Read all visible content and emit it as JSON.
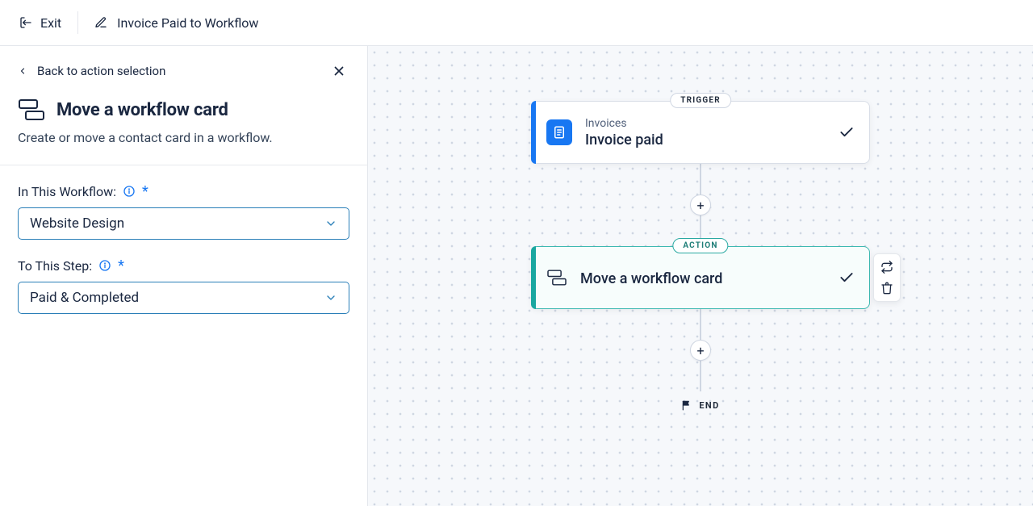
{
  "topbar": {
    "exit_label": "Exit",
    "workflow_name": "Invoice Paid to Workflow"
  },
  "panel": {
    "back_label": "Back to action selection",
    "title": "Move a workflow card",
    "description": "Create or move a contact card in a workflow.",
    "fields": {
      "workflow": {
        "label": "In This Workflow:",
        "value": "Website Design"
      },
      "step": {
        "label": "To This Step:",
        "value": "Paid & Completed"
      }
    }
  },
  "flow": {
    "trigger_badge": "TRIGGER",
    "action_badge": "ACTION",
    "trigger": {
      "category": "Invoices",
      "title": "Invoice paid"
    },
    "action": {
      "title": "Move a workflow card"
    },
    "end_label": "END"
  }
}
